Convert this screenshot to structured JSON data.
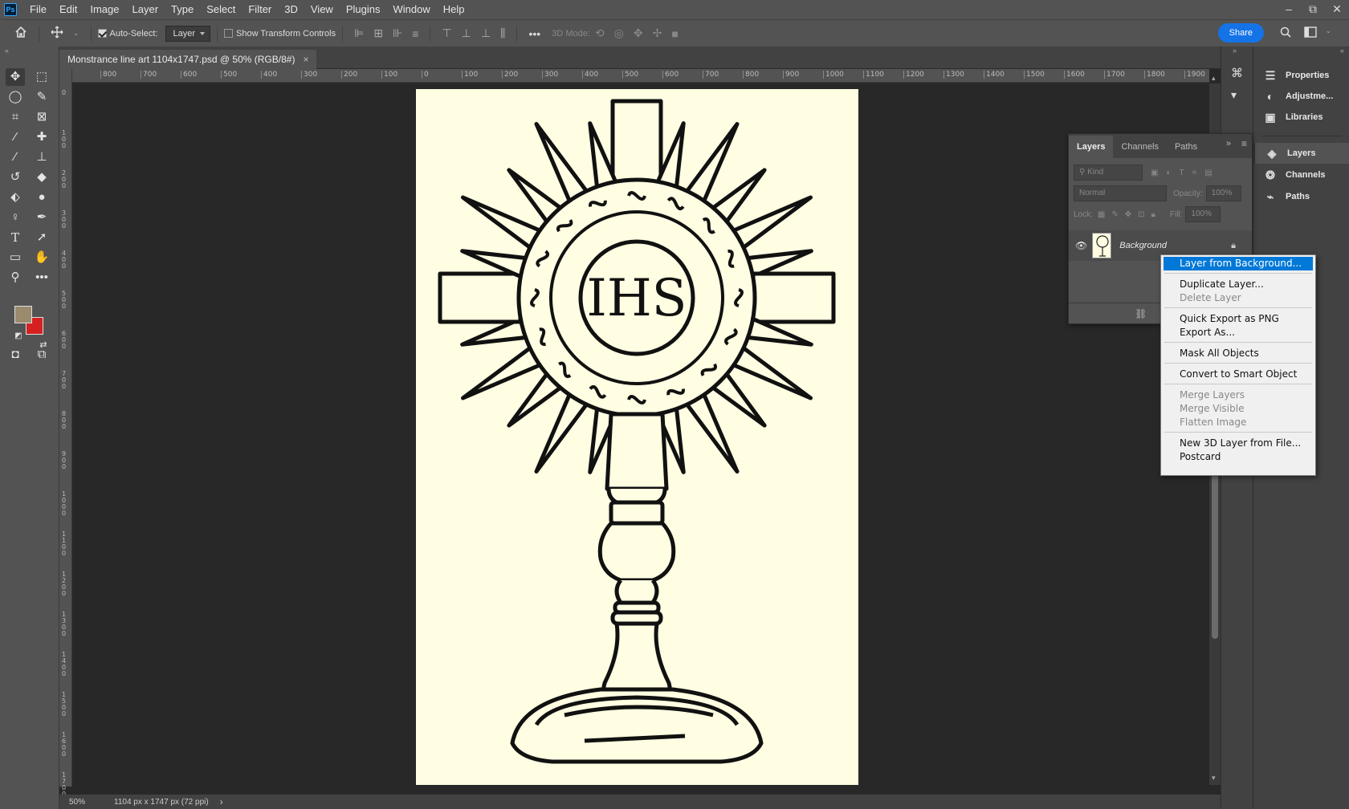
{
  "app": {
    "name": "Ps"
  },
  "menubar": {
    "items": [
      "File",
      "Edit",
      "Image",
      "Layer",
      "Type",
      "Select",
      "Filter",
      "3D",
      "View",
      "Plugins",
      "Window",
      "Help"
    ]
  },
  "window_controls": {
    "minimize": "–",
    "restore": "⧉",
    "close": "✕"
  },
  "options_bar": {
    "auto_select_label": "Auto-Select:",
    "auto_select_checked": true,
    "auto_select_target": "Layer",
    "show_transform_label": "Show Transform Controls",
    "mode_label": "3D Mode:",
    "share_label": "Share"
  },
  "colors": {
    "foreground": "#9c8a6c",
    "background": "#d42020",
    "accent": "#1473e6",
    "menu_highlight": "#0078d7"
  },
  "document": {
    "tab_title": "Monstrance line art 1104x1747.psd @ 50% (RGB/8#)",
    "close_glyph": "×",
    "artwork_text": "IHS"
  },
  "ruler": {
    "h_labels": [
      "800",
      "700",
      "600",
      "500",
      "400",
      "300",
      "200",
      "100",
      "0",
      "100",
      "200",
      "300",
      "400",
      "500",
      "600",
      "700",
      "800",
      "900",
      "1000",
      "1100",
      "1200",
      "1300",
      "1400",
      "1500",
      "1600",
      "1700",
      "1800",
      "1900"
    ],
    "v_labels": [
      "0",
      "1 0 0",
      "2 0 0",
      "3 0 0",
      "4 0 0",
      "5 0 0",
      "6 0 0",
      "7 0 0",
      "8 0 0",
      "9 0 0",
      "1 0 0 0",
      "1 1 0 0",
      "1 2 0 0",
      "1 3 0 0",
      "1 4 0 0",
      "1 5 0 0",
      "1 6 0 0",
      "1 7 0 0"
    ]
  },
  "status": {
    "zoom": "50%",
    "dimensions": "1104 px x 1747 px (72 ppi)",
    "arrow": "›"
  },
  "dock": {
    "items": [
      {
        "label": "Properties",
        "icon": "properties-icon"
      },
      {
        "label": "Adjustme...",
        "icon": "adjustments-icon"
      },
      {
        "label": "Libraries",
        "icon": "libraries-icon"
      },
      {
        "label": "Layers",
        "icon": "layers-icon"
      },
      {
        "label": "Channels",
        "icon": "channels-icon"
      },
      {
        "label": "Paths",
        "icon": "paths-icon"
      }
    ]
  },
  "layers_panel": {
    "tabs": [
      "Layers",
      "Channels",
      "Paths"
    ],
    "kind_placeholder": "Kind",
    "blend_mode": "Normal",
    "opacity_label": "Opacity:",
    "opacity_value": "100%",
    "lock_label": "Lock:",
    "fill_label": "Fill:",
    "fill_value": "100%",
    "layer_name": "Background"
  },
  "context_menu": {
    "items": [
      {
        "label": "Layer from Background...",
        "state": "highlighted"
      },
      {
        "label": "Duplicate Layer...",
        "state": "enabled"
      },
      {
        "label": "Delete Layer",
        "state": "disabled"
      },
      {
        "label": "Quick Export as PNG",
        "state": "enabled"
      },
      {
        "label": "Export As...",
        "state": "enabled"
      },
      {
        "label": "Mask All Objects",
        "state": "enabled"
      },
      {
        "label": "Convert to Smart Object",
        "state": "enabled"
      },
      {
        "label": "Merge Layers",
        "state": "disabled"
      },
      {
        "label": "Merge Visible",
        "state": "disabled"
      },
      {
        "label": "Flatten Image",
        "state": "disabled"
      },
      {
        "label": "New 3D Layer from File...",
        "state": "enabled"
      },
      {
        "label": "Postcard",
        "state": "enabled"
      }
    ]
  }
}
